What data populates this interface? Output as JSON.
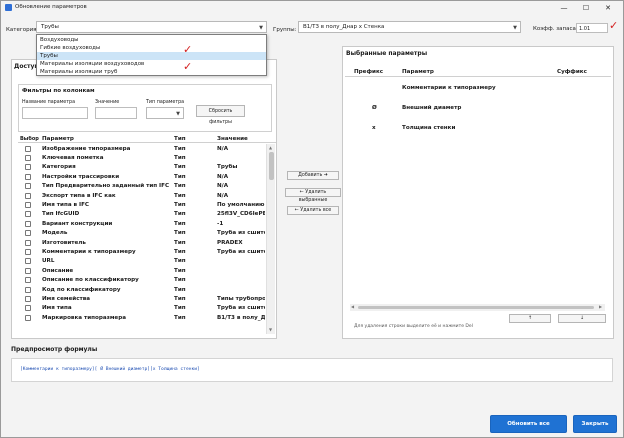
{
  "window": {
    "title": "Обновление параметров",
    "minimize": "—",
    "maximize": "☐",
    "close": "✕"
  },
  "top": {
    "category_label": "Категория",
    "category_value": "Трубы",
    "groups_label": "Группы:",
    "groups_value": "В1/Т3 в полу_Днар х Стенка",
    "coef_label": "Коэфф. запаса:",
    "coef_value": "1.01"
  },
  "category_dropdown": {
    "options": [
      "Воздуховоды",
      "Гибкие воздуховоды",
      "Трубы",
      "Материалы изоляции воздуховодов",
      "Материалы изоляции труб"
    ],
    "selected_index": 2
  },
  "available": {
    "title": "Доступ",
    "filters_title": "Фильтры по колонкам",
    "filter_name_label": "Название параметра",
    "filter_value_label": "Значение",
    "filter_type_label": "Тип параметра",
    "reset_filters": "Сбросить фильтры",
    "columns": [
      "Выбор",
      "Параметр",
      "Тип",
      "Значение"
    ],
    "rows": [
      [
        "Изображение типоразмера",
        "Тип",
        "N/A"
      ],
      [
        "Ключевая пометка",
        "Тип",
        ""
      ],
      [
        "Категория",
        "Тип",
        "Трубы"
      ],
      [
        "Настройки трассировки",
        "Тип",
        "N/A"
      ],
      [
        "Тип Предварительно заданный тип IFC",
        "Тип",
        "N/A"
      ],
      [
        "Экспорт типа в IFC как",
        "Тип",
        "N/A"
      ],
      [
        "Имя типа в IFC",
        "Тип",
        "По умолчанию"
      ],
      [
        "Тип IfcGUID",
        "Тип",
        "25fl3V_CD6IePE"
      ],
      [
        "Вариант конструкции",
        "Тип",
        "-1"
      ],
      [
        "Модель",
        "Тип",
        "Труба из сшито"
      ],
      [
        "Изготовитель",
        "Тип",
        "PRADEX"
      ],
      [
        "Комментарии к типоразмеру",
        "Тип",
        "Труба из сшито"
      ],
      [
        "URL",
        "Тип",
        ""
      ],
      [
        "Описание",
        "Тип",
        ""
      ],
      [
        "Описание по классификатору",
        "Тип",
        ""
      ],
      [
        "Код по классификатору",
        "Тип",
        ""
      ],
      [
        "Имя семейства",
        "Тип",
        "Типы трубопро"
      ],
      [
        "Имя типа",
        "Тип",
        "Труба из сшито"
      ],
      [
        "Маркировка типоразмера",
        "Тип",
        "В1/Т3 в полу_Д"
      ]
    ]
  },
  "actions": {
    "add": "Добавить ➜",
    "remove_selected": "← Удалить выбранные",
    "remove_all": "← Удалить все"
  },
  "selected": {
    "title": "Выбранные параметры",
    "columns": [
      "Префикс",
      "Параметр",
      "Суффикс"
    ],
    "rows": [
      [
        "",
        "Комментарии к типоразмеру",
        ""
      ],
      [
        "Ø",
        "Внешний диаметр",
        ""
      ],
      [
        "x",
        "Толщина стенки",
        ""
      ]
    ],
    "up": "↑",
    "down": "↓",
    "hint": "Для удаления строки выделите её и нажмите Del"
  },
  "preview": {
    "title": "Предпросмотр формулы",
    "formula": "[Комментарии к типоразмеру][ Ø Внешний диаметр][x Толщина стенки]"
  },
  "footer": {
    "update_all": "Обновить все элементы",
    "close": "Закрыть"
  },
  "colors": {
    "accent": "#1f72d3",
    "annotation": "#d32020",
    "selection": "#cce4f7"
  }
}
